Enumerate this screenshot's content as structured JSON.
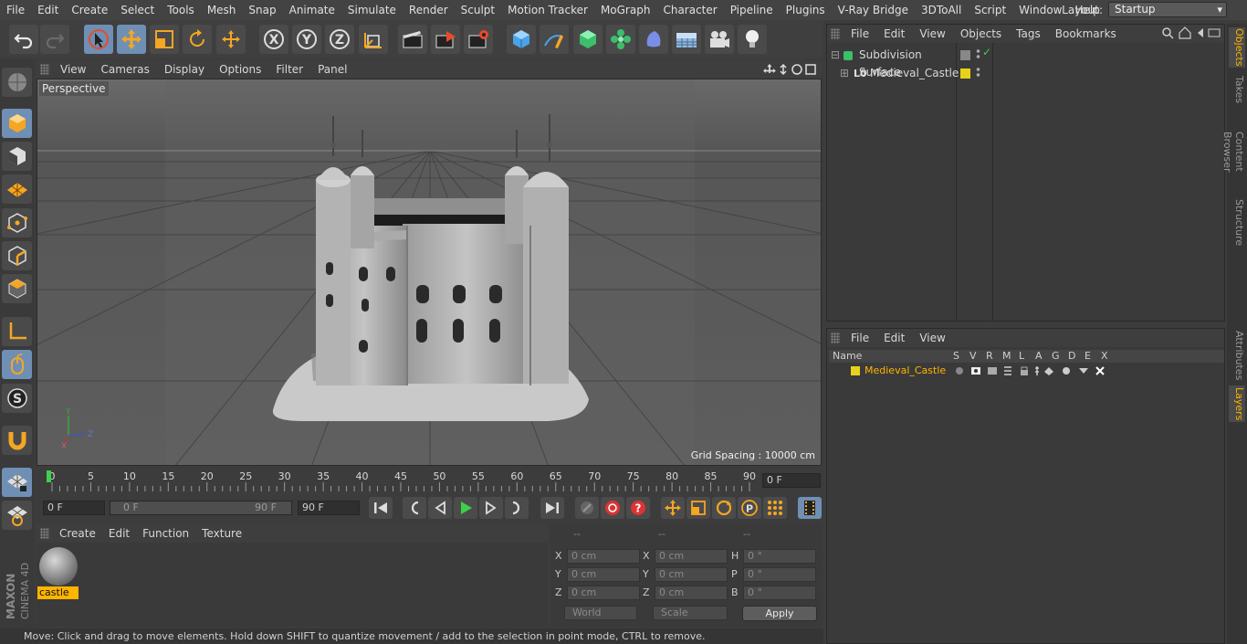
{
  "menu": [
    "File",
    "Edit",
    "Create",
    "Select",
    "Tools",
    "Mesh",
    "Snap",
    "Animate",
    "Simulate",
    "Render",
    "Sculpt",
    "Motion Tracker",
    "MoGraph",
    "Character",
    "Pipeline",
    "Plugins",
    "V-Ray Bridge",
    "3DToAll",
    "Script",
    "Window",
    "Help"
  ],
  "layout": {
    "label": "Layout:",
    "value": "Startup"
  },
  "viewport": {
    "menu": [
      "View",
      "Cameras",
      "Display",
      "Options",
      "Filter",
      "Panel"
    ],
    "label": "Perspective",
    "grid_spacing": "Grid Spacing : 10000 cm",
    "axis": {
      "y": "Y",
      "z": "Z",
      "x": "X"
    }
  },
  "timeline": {
    "ticks": [
      "0",
      "5",
      "10",
      "15",
      "20",
      "25",
      "30",
      "35",
      "40",
      "45",
      "50",
      "55",
      "60",
      "65",
      "70",
      "75",
      "80",
      "85",
      "90"
    ],
    "current_frame": "0 F",
    "start_field": "0 F",
    "range_start": "0 F",
    "range_end": "90 F",
    "end_field": "90 F"
  },
  "material_panel": {
    "menu": [
      "Create",
      "Edit",
      "Function",
      "Texture"
    ],
    "material_name": "castle"
  },
  "coords": {
    "headers": [
      "--",
      "--",
      "--"
    ],
    "rows": [
      {
        "a": "X",
        "av": "0 cm",
        "b": "X",
        "bv": "0 cm",
        "c": "H",
        "cv": "0 °"
      },
      {
        "a": "Y",
        "av": "0 cm",
        "b": "Y",
        "bv": "0 cm",
        "c": "P",
        "cv": "0 °"
      },
      {
        "a": "Z",
        "av": "0 cm",
        "b": "Z",
        "bv": "0 cm",
        "c": "B",
        "cv": "0 °"
      }
    ],
    "world": "World",
    "scale": "Scale",
    "apply": "Apply"
  },
  "status": "Move: Click and drag to move elements. Hold down SHIFT to quantize movement / add to the selection in point mode, CTRL to remove.",
  "objects_panel": {
    "menu": [
      "File",
      "Edit",
      "View",
      "Objects",
      "Tags",
      "Bookmarks"
    ],
    "items": [
      "Subdivision Surface",
      "Medieval_Castle"
    ]
  },
  "layers_panel": {
    "menu": [
      "File",
      "Edit",
      "View"
    ],
    "columns": [
      "Name",
      "S",
      "V",
      "R",
      "M",
      "L",
      "A",
      "G",
      "D",
      "E",
      "X"
    ],
    "layer": "Medieval_Castle"
  },
  "side_tabs": [
    "Objects",
    "Takes",
    "Content Browser",
    "Structure",
    "Attributes",
    "Layers"
  ],
  "brand": {
    "line1": "MAXON",
    "line2": "CINEMA 4D"
  },
  "colors": {
    "accent": "#6f8fb5",
    "highlight": "#ffb400",
    "layer_color": "#e6d21a"
  }
}
